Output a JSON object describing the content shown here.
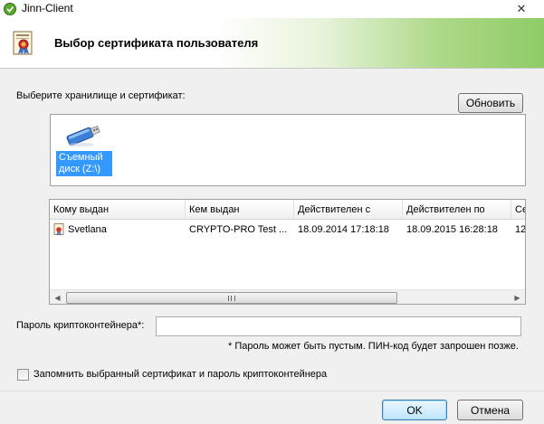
{
  "window": {
    "title": "Jinn-Client",
    "close_glyph": "✕"
  },
  "banner": {
    "title": "Выбор сертификата пользователя",
    "icon": "certificate-icon"
  },
  "storage": {
    "label": "Выберите хранилище и сертификат:",
    "refresh_label": "Обновить",
    "items": [
      {
        "label": "Съемный диск (Z:\\)",
        "icon": "usb-drive-icon",
        "selected": true
      }
    ]
  },
  "table": {
    "columns": [
      "Кому выдан",
      "Кем выдан",
      "Действителен с",
      "Действителен по",
      "Се"
    ],
    "rows": [
      [
        "Svetlana",
        "CRYPTO-PRO Test ...",
        "18.09.2014 17:18:18",
        "18.09.2015 16:28:18",
        "12"
      ]
    ],
    "scroll_left": "◀",
    "scroll_right": "▶"
  },
  "password": {
    "label": "Пароль криптоконтейнера*:",
    "value": "",
    "hint": "* Пароль может быть пустым. ПИН-код будет запрошен позже."
  },
  "remember": {
    "label": "Запомнить выбранный сертификат и пароль криптоконтейнера",
    "checked": false
  },
  "buttons": {
    "ok": "OK",
    "cancel": "Отмена"
  },
  "colors": {
    "selection": "#3399ff",
    "banner_green": "#8fcc66"
  }
}
